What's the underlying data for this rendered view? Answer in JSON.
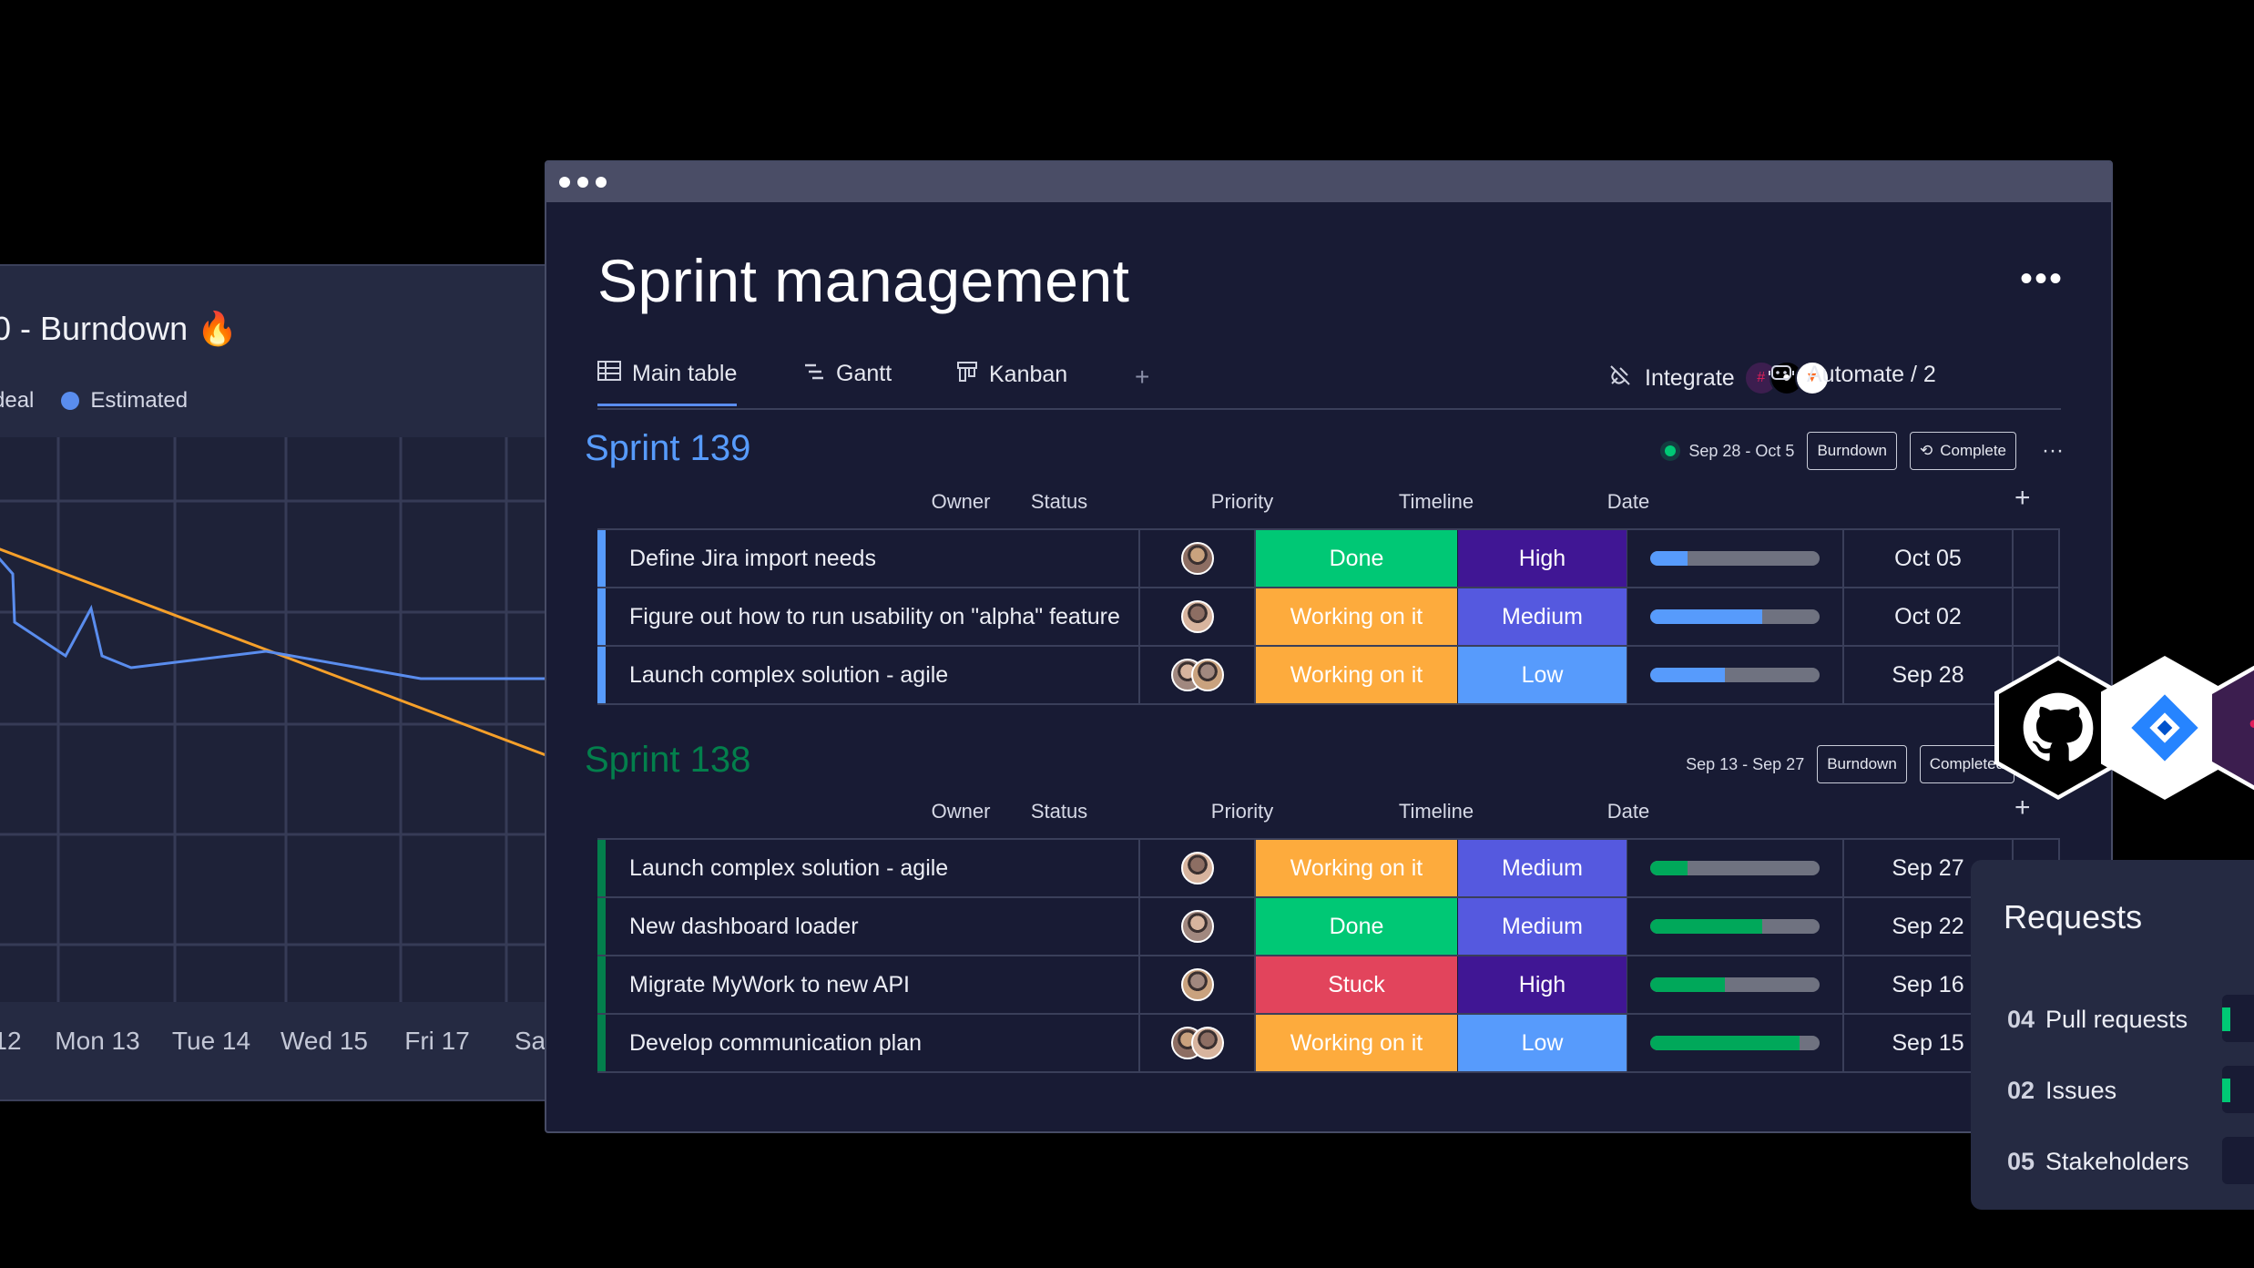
{
  "burndown": {
    "title": "0 - Burndown 🔥",
    "legend": [
      "deal",
      "Estimated"
    ],
    "x_labels": [
      "12",
      "Mon 13",
      "Tue 14",
      "Wed 15",
      "Fri 17",
      "Sa"
    ],
    "colors": {
      "ideal": "#f6a02a",
      "estimated": "#5a8dee"
    }
  },
  "window": {
    "title": "Sprint management",
    "more": "•••"
  },
  "tabs": {
    "main": "Main table",
    "gantt": "Gantt",
    "kanban": "Kanban",
    "add": "+",
    "integrate": "Integrate",
    "automate": "Automate / 2"
  },
  "columns": {
    "owner": "Owner",
    "status": "Status",
    "priority": "Priority",
    "timeline": "Timeline",
    "date": "Date",
    "add": "+"
  },
  "groups": [
    {
      "title": "Sprint 139",
      "color": "#579bfc",
      "dates": "Sep 28 - Oct 5",
      "btn_burndown": "Burndown",
      "btn_complete": "Complete",
      "more": "···",
      "rows": [
        {
          "name": "Define Jira import needs",
          "status": "Done",
          "status_color": "#00c875",
          "priority": "High",
          "priority_color": "#401694",
          "progress": 0.22,
          "date": "Oct 05",
          "avatars": 1
        },
        {
          "name": "Figure out how to run usability on \"alpha\" feature",
          "status": "Working on it",
          "status_color": "#fdab3d",
          "priority": "Medium",
          "priority_color": "#5559df",
          "progress": 0.66,
          "date": "Oct 02",
          "avatars": 1
        },
        {
          "name": "Launch complex solution - agile",
          "status": "Working on it",
          "status_color": "#fdab3d",
          "priority": "Low",
          "priority_color": "#579bfc",
          "progress": 0.44,
          "date": "Sep 28",
          "avatars": 2
        }
      ]
    },
    {
      "title": "Sprint 138",
      "color": "#037f4c",
      "dates": "Sep 13 - Sep 27",
      "btn_burndown": "Burndown",
      "btn_complete": "Completed",
      "rows": [
        {
          "name": "Launch complex solution - agile",
          "status": "Working on it",
          "status_color": "#fdab3d",
          "priority": "Medium",
          "priority_color": "#5559df",
          "progress": 0.22,
          "date": "Sep 27",
          "avatars": 1
        },
        {
          "name": "New dashboard loader",
          "status": "Done",
          "status_color": "#00c875",
          "priority": "Medium",
          "priority_color": "#5559df",
          "progress": 0.66,
          "date": "Sep 22",
          "avatars": 1
        },
        {
          "name": "Migrate MyWork to new API",
          "status": "Stuck",
          "status_color": "#e2445c",
          "priority": "High",
          "priority_color": "#401694",
          "progress": 0.44,
          "date": "Sep 16",
          "avatars": 1
        },
        {
          "name": "Develop communication plan",
          "status": "Working on it",
          "status_color": "#fdab3d",
          "priority": "Low",
          "priority_color": "#579bfc",
          "progress": 0.88,
          "date": "Sep 15",
          "avatars": 2
        }
      ]
    }
  ],
  "requests": {
    "title": "Requests",
    "items": [
      {
        "count": "04",
        "label": "Pull requests"
      },
      {
        "count": "02",
        "label": "Issues"
      },
      {
        "count": "05",
        "label": "Stakeholders"
      }
    ]
  },
  "integrations": [
    "github-icon",
    "jira-icon",
    "slack-icon"
  ]
}
